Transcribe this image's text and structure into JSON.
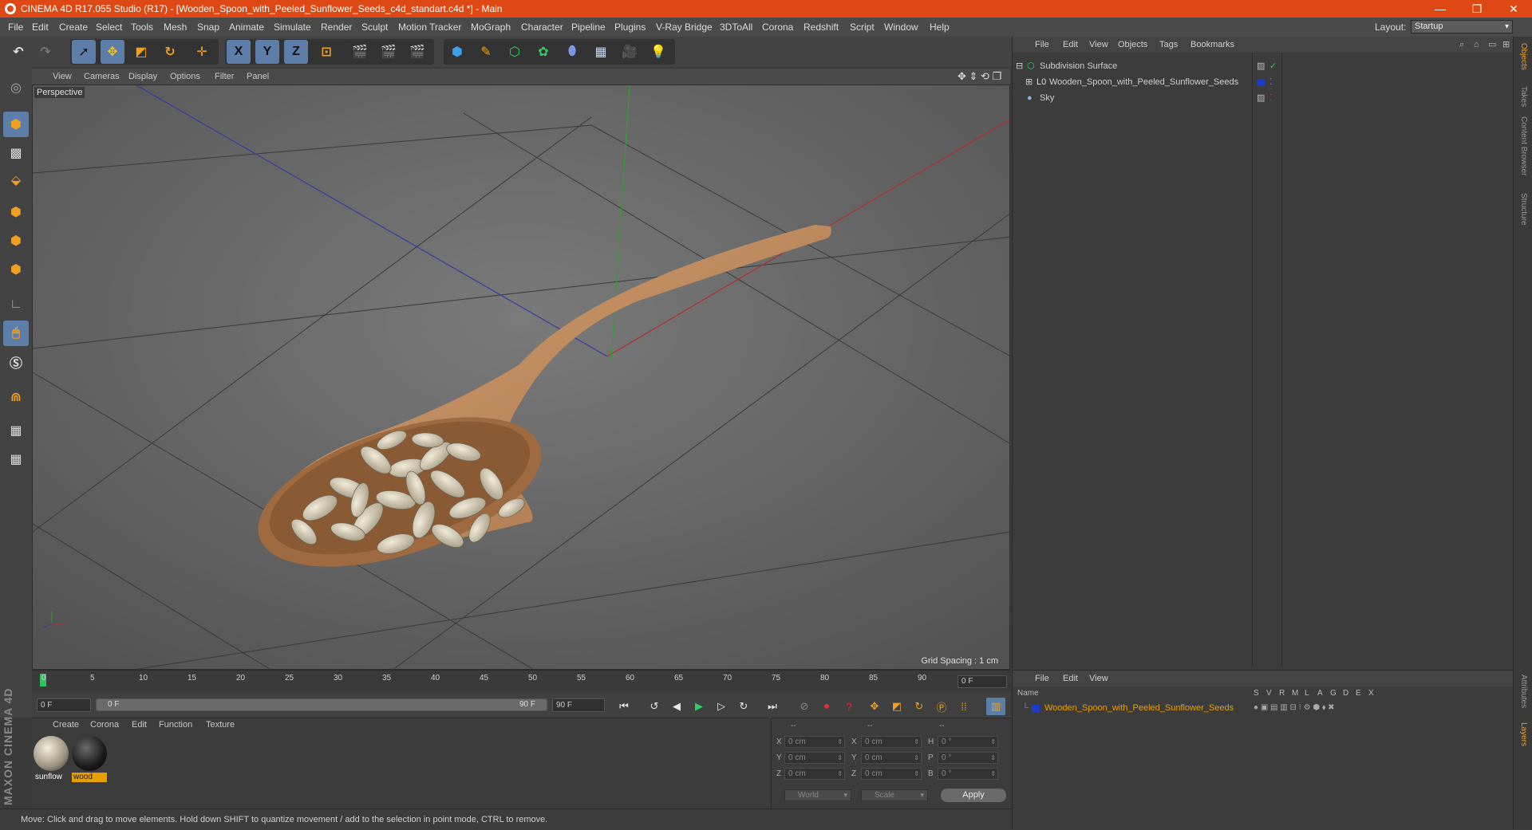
{
  "window": {
    "title": "CINEMA 4D R17.055 Studio (R17) - [Wooden_Spoon_with_Peeled_Sunflower_Seeds_c4d_standart.c4d *] - Main",
    "minimize": "—",
    "restore": "❐",
    "close": "✕"
  },
  "menu": [
    "File",
    "Edit",
    "Create",
    "Select",
    "Tools",
    "Mesh",
    "Snap",
    "Animate",
    "Simulate",
    "Render",
    "Sculpt",
    "Motion Tracker",
    "MoGraph",
    "Character",
    "Pipeline",
    "Plugins",
    "V-Ray Bridge",
    "3DToAll",
    "Corona",
    "Redshift",
    "Script",
    "Window",
    "Help"
  ],
  "layout": {
    "label": "Layout:",
    "value": "Startup"
  },
  "toolbar": {
    "x_axis": "X",
    "y_axis": "Y",
    "z_axis": "Z"
  },
  "viewport": {
    "menu": [
      "View",
      "Cameras",
      "Display",
      "Options",
      "Filter",
      "Panel"
    ],
    "camera_label": "Perspective",
    "grid_spacing": "Grid Spacing : 1 cm"
  },
  "timeline": {
    "ticks": [
      "0",
      "5",
      "10",
      "15",
      "20",
      "25",
      "30",
      "35",
      "40",
      "45",
      "50",
      "55",
      "60",
      "65",
      "70",
      "75",
      "80",
      "85",
      "90"
    ],
    "current_frame": "0 F",
    "start_field": "0 F",
    "slider_start": "0 F",
    "slider_end": "90 F",
    "end_field": "90 F"
  },
  "materials": {
    "menu": [
      "Create",
      "Corona",
      "Edit",
      "Function",
      "Texture"
    ],
    "items": [
      {
        "name": "sunflow",
        "label_color": "#3c3c3c"
      },
      {
        "name": "wood",
        "label_color": "#e8a000"
      }
    ]
  },
  "coordinates": {
    "headers": [
      "--",
      "--",
      "--"
    ],
    "rows": [
      {
        "a": "X",
        "av": "0 cm",
        "b": "X",
        "bv": "0 cm",
        "c": "H",
        "cv": "0 °"
      },
      {
        "a": "Y",
        "av": "0 cm",
        "b": "Y",
        "bv": "0 cm",
        "c": "P",
        "cv": "0 °"
      },
      {
        "a": "Z",
        "av": "0 cm",
        "b": "Z",
        "bv": "0 cm",
        "c": "B",
        "cv": "0 °"
      }
    ],
    "world": "World",
    "scale": "Scale",
    "apply": "Apply"
  },
  "status": "Move: Click and drag to move elements. Hold down SHIFT to quantize movement / add to the selection in point mode, CTRL to remove.",
  "brand": "MAXON CINEMA 4D",
  "object_manager": {
    "menu": [
      "File",
      "Edit",
      "View",
      "Objects",
      "Tags",
      "Bookmarks"
    ],
    "objects": [
      {
        "name": "Subdivision Surface",
        "expander": "⊟",
        "indent": 0
      },
      {
        "name": "Wooden_Spoon_with_Peeled_Sunflower_Seeds",
        "expander": "⊞",
        "indent": 1
      },
      {
        "name": "Sky",
        "expander": "",
        "indent": 0
      }
    ]
  },
  "layer_manager": {
    "menu": [
      "File",
      "Edit",
      "View"
    ],
    "name_header": "Name",
    "columns": [
      "S",
      "V",
      "R",
      "M",
      "L",
      "A",
      "G",
      "D",
      "E",
      "X"
    ],
    "layers": [
      {
        "name": "Wooden_Spoon_with_Peeled_Sunflower_Seeds",
        "color": "#1a3cc8"
      }
    ]
  },
  "right_tabs": [
    "Objects",
    "Takes",
    "Content Browser",
    "Structure",
    "Attributes",
    "Layers"
  ],
  "colors": {
    "accent": "#dd4814",
    "selected": "#5d7ea8",
    "layer_text": "#e8a000"
  }
}
